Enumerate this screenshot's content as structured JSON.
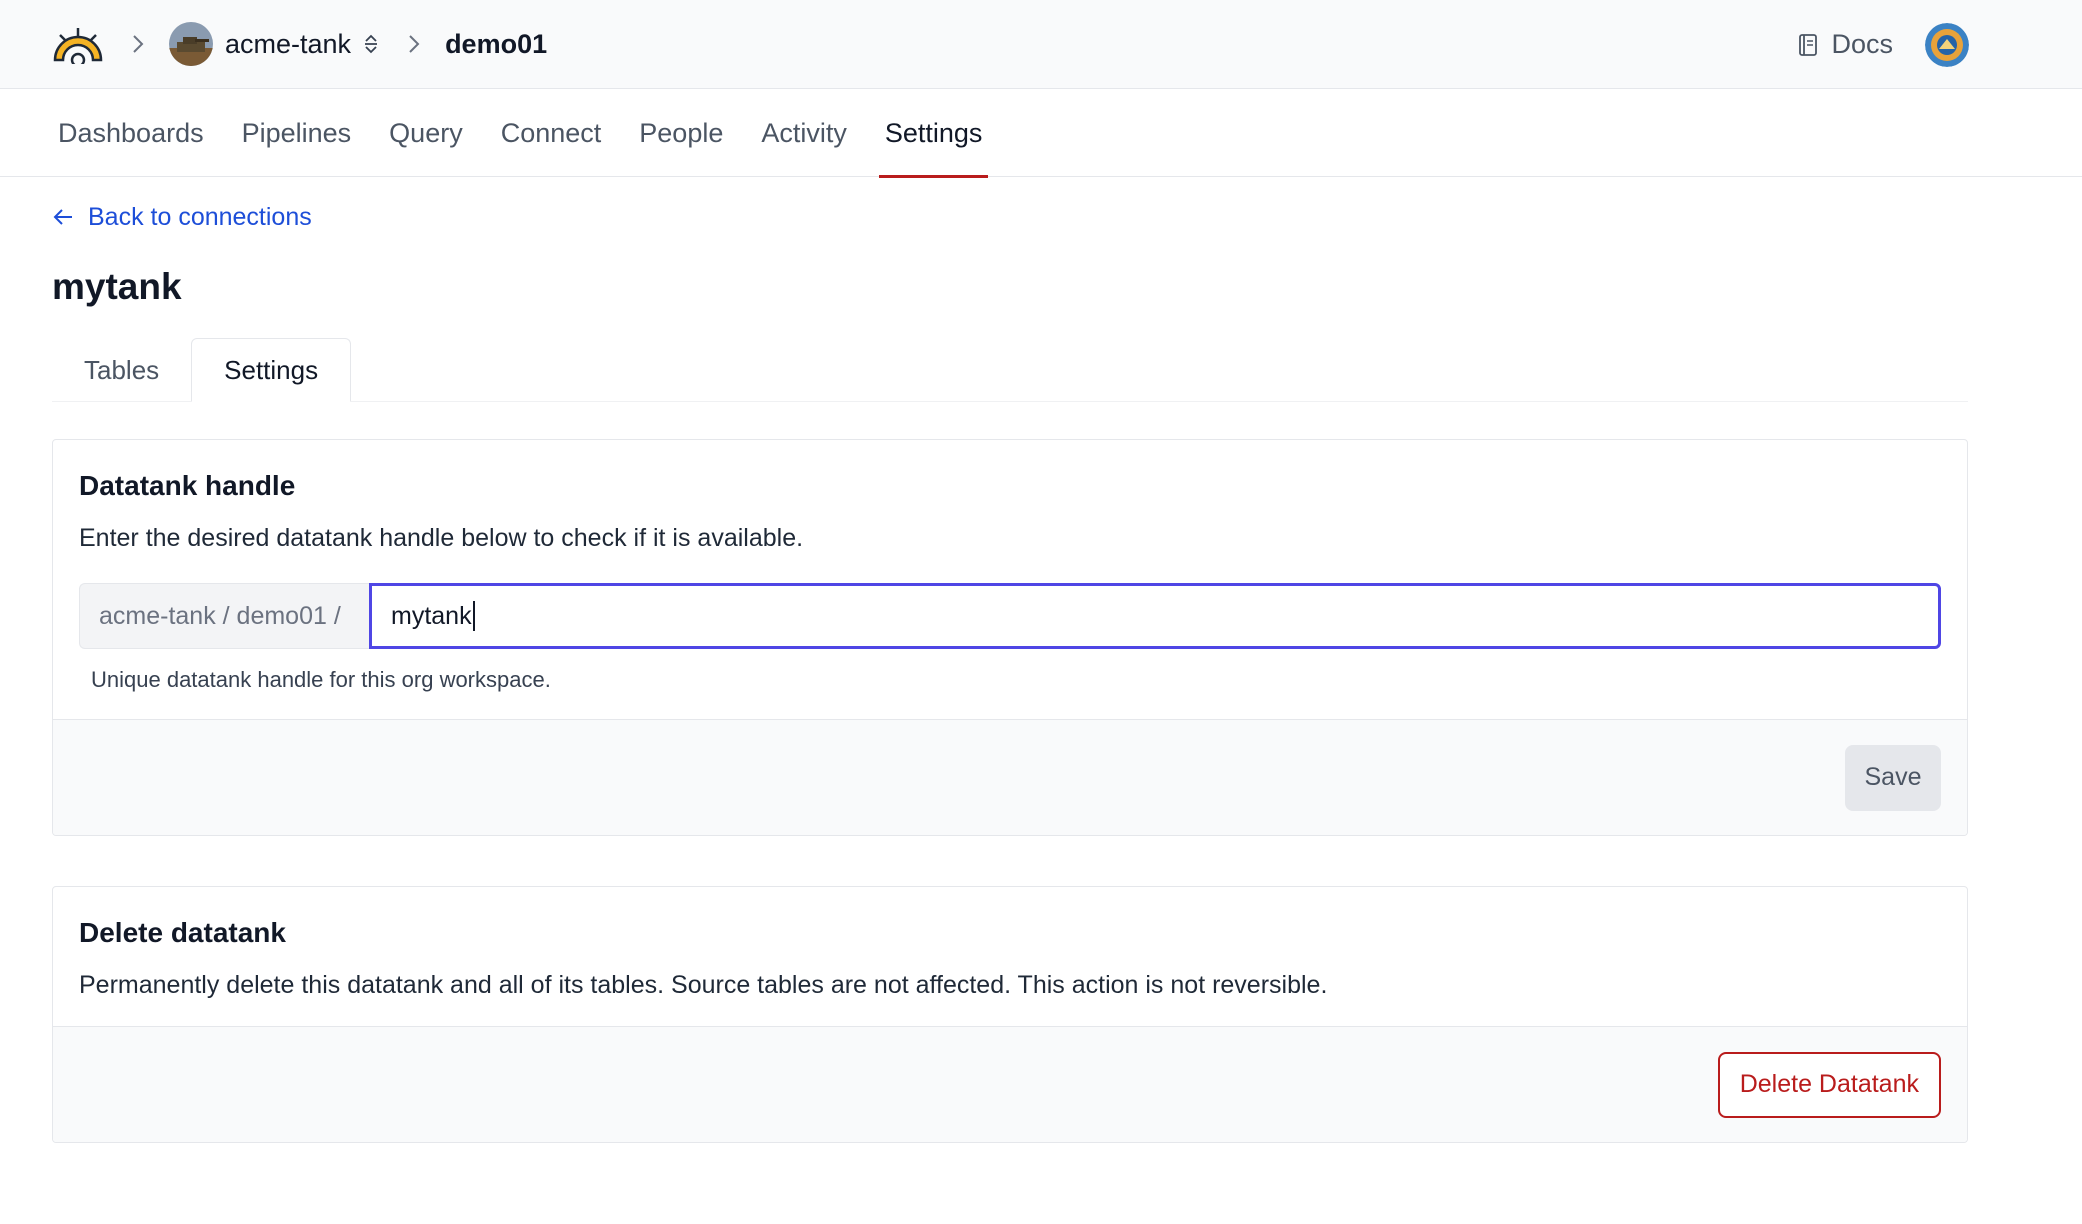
{
  "breadcrumb": {
    "org": "acme-tank",
    "workspace": "demo01"
  },
  "header": {
    "docs_label": "Docs"
  },
  "nav": {
    "items": [
      {
        "label": "Dashboards"
      },
      {
        "label": "Pipelines"
      },
      {
        "label": "Query"
      },
      {
        "label": "Connect"
      },
      {
        "label": "People"
      },
      {
        "label": "Activity"
      },
      {
        "label": "Settings"
      }
    ],
    "active": "Settings"
  },
  "page": {
    "back_label": "Back to connections",
    "title": "mytank",
    "tabs": [
      {
        "label": "Tables"
      },
      {
        "label": "Settings"
      }
    ],
    "active_tab": "Settings"
  },
  "handle_card": {
    "title": "Datatank handle",
    "description": "Enter the desired datatank handle below to check if it is available.",
    "prefix": "acme-tank / demo01 /",
    "value": "mytank",
    "help": "Unique datatank handle for this org workspace.",
    "save_label": "Save"
  },
  "delete_card": {
    "title": "Delete datatank",
    "description": "Permanently delete this datatank and all of its tables. Source tables are not affected. This action is not reversible.",
    "button_label": "Delete Datatank"
  },
  "colors": {
    "accent": "#b91c1c",
    "link": "#1d4ed8",
    "focus": "#4f46e5",
    "logo_yellow": "#f5b324"
  }
}
